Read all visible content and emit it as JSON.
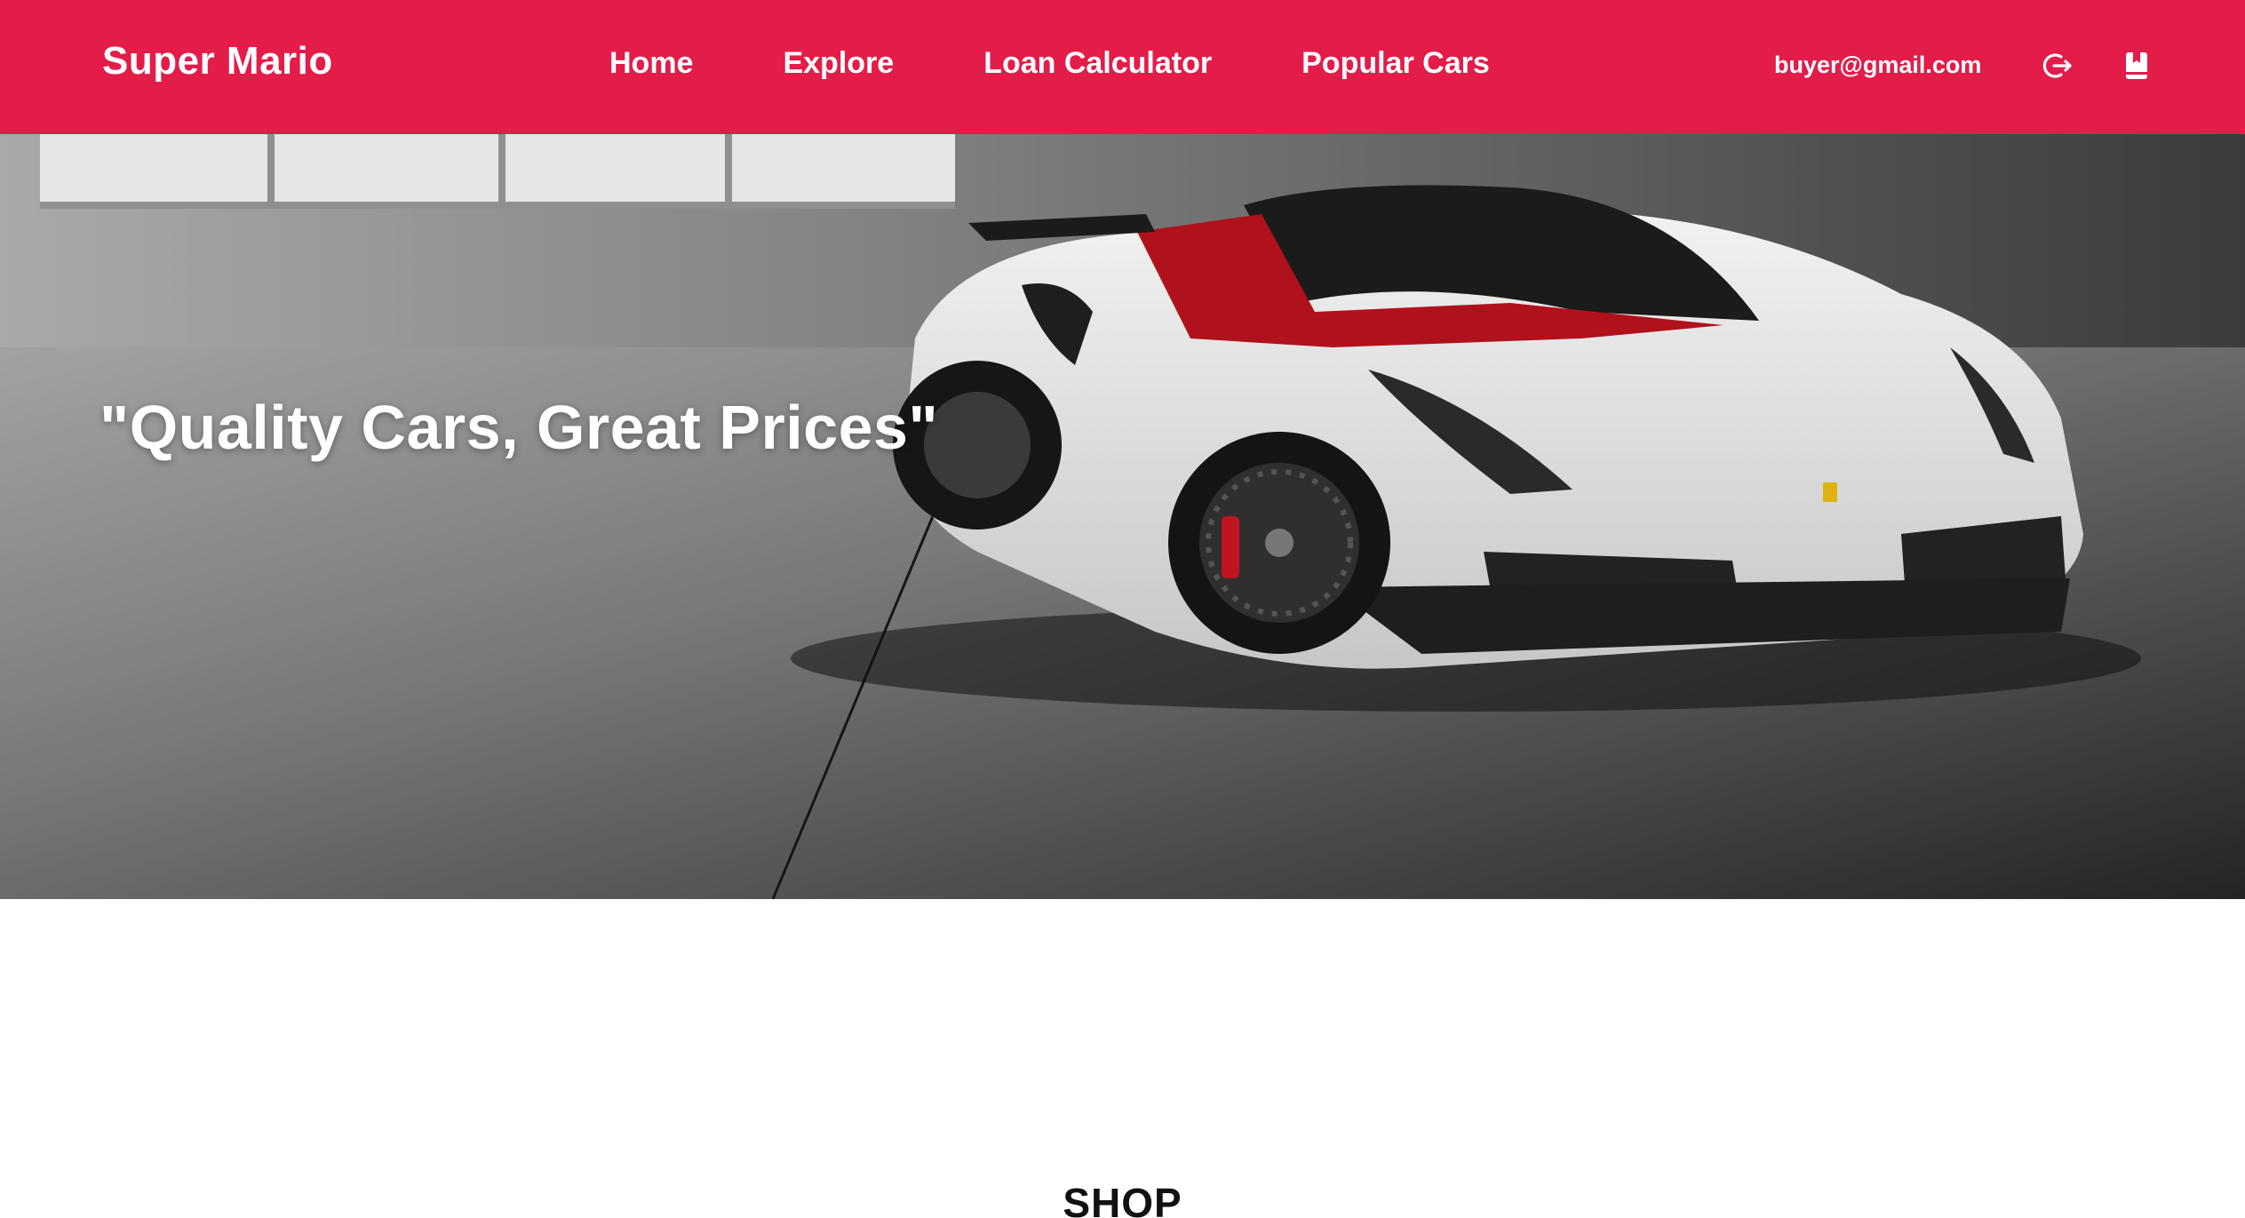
{
  "navbar": {
    "brand": "Super Mario",
    "links": [
      {
        "label": "Home"
      },
      {
        "label": "Explore"
      },
      {
        "label": "Loan Calculator"
      },
      {
        "label": "Popular Cars"
      }
    ],
    "user_email": "buyer@gmail.com",
    "icons": {
      "logout": "logout-icon",
      "bookmark": "bookmark-icon"
    },
    "color": "#e31c4a"
  },
  "hero": {
    "quote": "\"Quality Cars, Great Prices\"",
    "image": "white-convertible-sports-car"
  },
  "shop": {
    "title": "SHOP"
  }
}
